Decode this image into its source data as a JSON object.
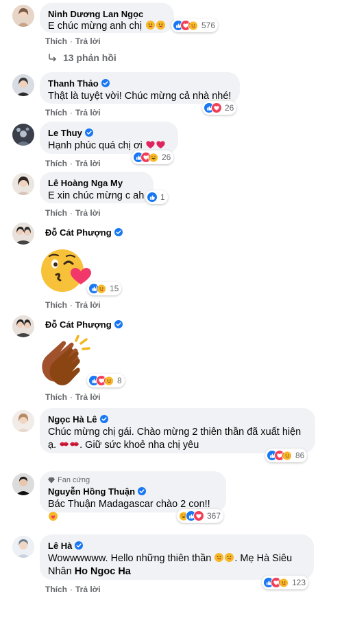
{
  "actions": {
    "like": "Thích",
    "reply": "Trả lời",
    "dot": "·"
  },
  "colors": {
    "like": "#1877f2",
    "love": "#f33e58",
    "care": "#f7b928",
    "verified": "#1877f2",
    "meta": "#65676b",
    "bubble": "#f0f2f5"
  },
  "comments": [
    {
      "name": "Ninh Dương Lan Ngọc",
      "verified": false,
      "text": "E chúc mừng anh chị",
      "reactions": [
        "like",
        "love",
        "care"
      ],
      "count": "576",
      "replies": "13 phản hồi"
    },
    {
      "name": "Thanh Thảo",
      "verified": true,
      "text": "Thật là tuyệt vời! Chúc mừng cả nhà nhé!",
      "reactions": [
        "like",
        "love"
      ],
      "count": "26"
    },
    {
      "name": "Le Thuy",
      "verified": true,
      "text": "Hạnh phúc quá chị ơi",
      "reactions": [
        "like",
        "love",
        "haha"
      ],
      "count": "26"
    },
    {
      "name": "Lê Hoàng Nga My",
      "verified": false,
      "text": "E xin chúc mừng c ah",
      "reactions": [
        "like"
      ],
      "count": "1"
    },
    {
      "name": "Đỗ Cát Phượng",
      "verified": true,
      "sticker": "kiss-wink-emoji",
      "reactions": [
        "like",
        "care"
      ],
      "count": "15"
    },
    {
      "name": "Đỗ Cát Phượng",
      "verified": true,
      "sticker": "clapping-hands-emoji",
      "reactions": [
        "like",
        "love",
        "care"
      ],
      "count": "8"
    },
    {
      "name": "Ngọc Hà Lê",
      "verified": true,
      "text1": "Chúc mừng chị gái. Chào mừng 2 thiên thần đã xuất hiện",
      "text2": "ạ.",
      "text3": ". Giữ sức khoẻ nha chị yêu",
      "reactions": [
        "like",
        "love",
        "care"
      ],
      "count": "86"
    },
    {
      "fan_badge": "Fan cứng",
      "name": "Nguyễn Hồng Thuận",
      "verified": true,
      "text": "Bác Thuận Madagascar chào 2 con!!",
      "reactions": [
        "haha",
        "like",
        "love"
      ],
      "count": "367"
    },
    {
      "name": "Lê Hà",
      "verified": true,
      "text1": "Wowwwwww. Hello những thiên thần",
      "text2": ". Mẹ Hà Siêu",
      "text3": "Nhân",
      "mention": "Ho Ngoc Ha",
      "reactions": [
        "like",
        "love",
        "care"
      ],
      "count": "123"
    }
  ]
}
